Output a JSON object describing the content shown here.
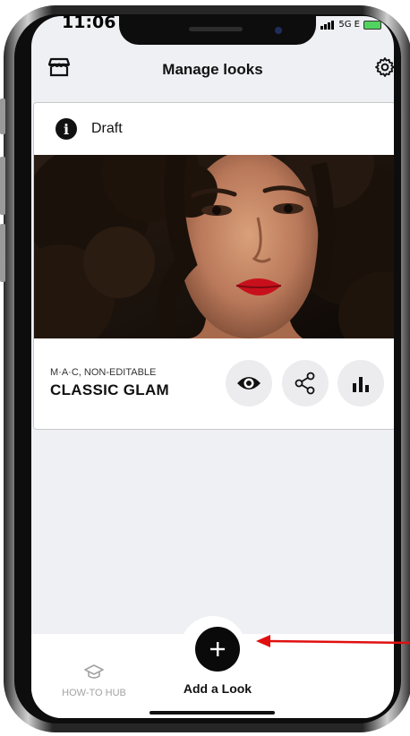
{
  "status_bar": {
    "time": "11:06",
    "network": "5G E"
  },
  "header": {
    "title": "Manage looks",
    "left_icon": "store-icon",
    "right_icon": "gear-icon"
  },
  "look_card": {
    "status_icon": "info-icon",
    "status_label": "Draft",
    "brand_label": "M·A·C, NON-EDITABLE",
    "look_name": "CLASSIC GLAM",
    "actions": [
      {
        "icon": "eye-icon",
        "name": "preview"
      },
      {
        "icon": "share-icon",
        "name": "share"
      },
      {
        "icon": "bar-chart-icon",
        "name": "analytics"
      }
    ]
  },
  "bottom_nav": {
    "how_to_hub_label": "HOW-TO HUB",
    "how_to_hub_icon": "graduation-cap-icon",
    "add_look_label": "Add a Look",
    "add_look_icon": "plus-icon"
  },
  "colors": {
    "background": "#eff0f4",
    "accent": "#0a0a0a",
    "annotation_arrow": "#e01010",
    "muted_text": "#a3a3a3"
  }
}
